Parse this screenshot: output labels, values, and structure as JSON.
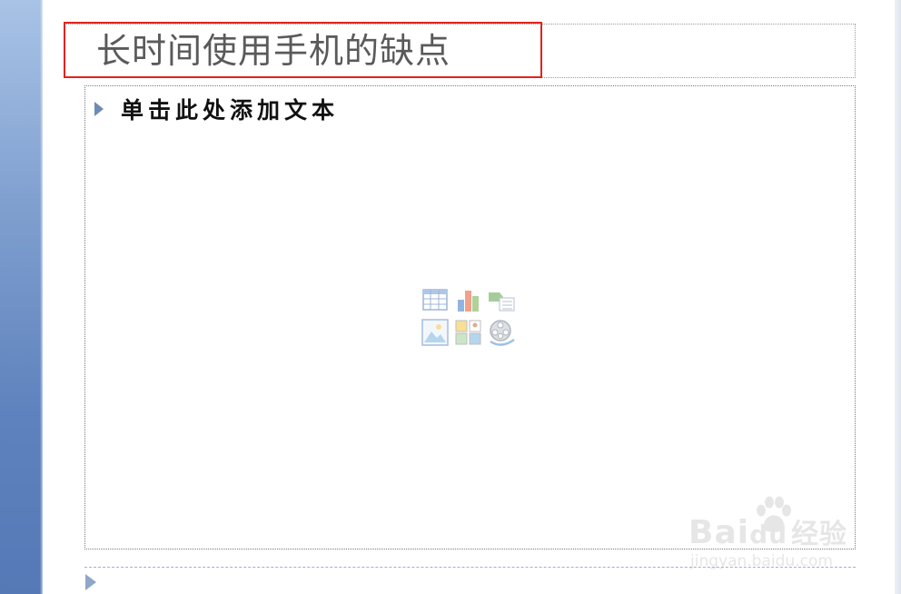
{
  "slide": {
    "title": "长时间使用手机的缺点",
    "body_placeholder": "单击此处添加文本"
  },
  "insert_icons": [
    {
      "name": "insert-table-icon"
    },
    {
      "name": "insert-chart-icon"
    },
    {
      "name": "insert-smartart-icon"
    },
    {
      "name": "insert-picture-icon"
    },
    {
      "name": "insert-clipart-icon"
    },
    {
      "name": "insert-media-icon"
    }
  ],
  "watermark": {
    "brand_latin": "Bai",
    "brand_du": "du",
    "brand_cn": "经验",
    "url": "jingyan.baidu.com"
  },
  "colors": {
    "highlight_border": "#e2231a",
    "bullet": "#6e8bb7",
    "left_band": "#6f8fc6",
    "title_text": "#5a5a5a"
  }
}
